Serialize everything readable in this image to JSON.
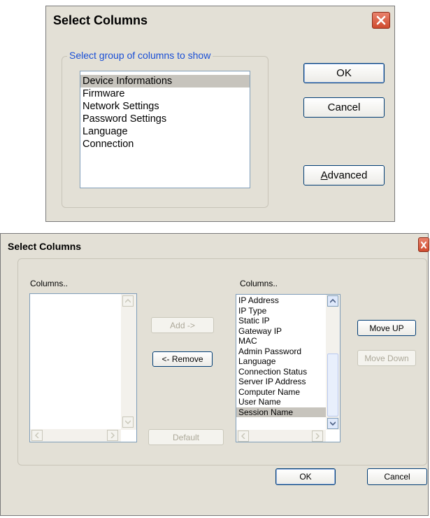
{
  "dialog1": {
    "title": "Select Columns",
    "group_label": "Select group of columns to show",
    "items": [
      {
        "label": "Device Informations",
        "selected": true
      },
      {
        "label": "Firmware",
        "selected": false
      },
      {
        "label": "Network Settings",
        "selected": false
      },
      {
        "label": "Password Settings",
        "selected": false
      },
      {
        "label": "Language",
        "selected": false
      },
      {
        "label": "Connection",
        "selected": false
      }
    ],
    "ok_label": "OK",
    "cancel_label": "Cancel",
    "advanced_label": "Advanced",
    "advanced_mnemonic": "A",
    "advanced_rest": "dvanced"
  },
  "dialog2": {
    "title": "Select Columns",
    "left_label": "Columns..",
    "right_label": "Columns..",
    "left_items": [],
    "right_items": [
      {
        "label": "IP Address",
        "selected": false
      },
      {
        "label": "IP Type",
        "selected": false
      },
      {
        "label": "Static IP",
        "selected": false
      },
      {
        "label": "Gateway IP",
        "selected": false
      },
      {
        "label": "MAC",
        "selected": false
      },
      {
        "label": "Admin Password",
        "selected": false
      },
      {
        "label": "Language",
        "selected": false
      },
      {
        "label": "Connection Status",
        "selected": false
      },
      {
        "label": "Server IP Address",
        "selected": false
      },
      {
        "label": "Computer Name",
        "selected": false
      },
      {
        "label": "User Name",
        "selected": false
      },
      {
        "label": "Session Name",
        "selected": true
      }
    ],
    "add_label": "Add ->",
    "remove_label": "<- Remove",
    "default_label": "Default",
    "move_up_label": "Move UP",
    "move_down_label": "Move Down",
    "ok_label": "OK",
    "cancel_label": "Cancel"
  },
  "colors": {
    "dialog_bg": "#e3e0d6",
    "group_label": "#1a4fd6",
    "selection": "#c7c4bd",
    "close_button": "#d9573b"
  }
}
